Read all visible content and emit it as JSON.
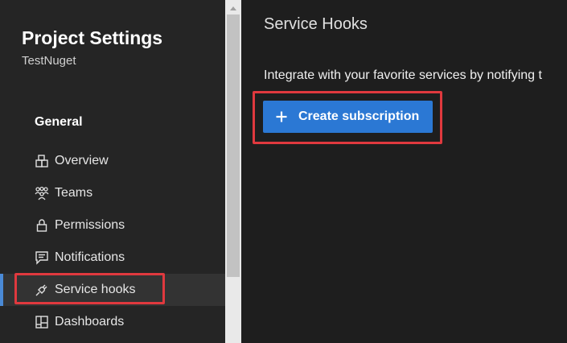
{
  "sidebar": {
    "title": "Project Settings",
    "subtitle": "TestNuget",
    "section": "General",
    "items": [
      {
        "label": "Overview",
        "icon": "overview-icon"
      },
      {
        "label": "Teams",
        "icon": "teams-icon"
      },
      {
        "label": "Permissions",
        "icon": "lock-icon"
      },
      {
        "label": "Notifications",
        "icon": "notifications-icon"
      },
      {
        "label": "Service hooks",
        "icon": "plug-icon",
        "selected": true
      },
      {
        "label": "Dashboards",
        "icon": "dashboards-icon"
      }
    ]
  },
  "main": {
    "title": "Service Hooks",
    "description": "Integrate with your favorite services by notifying t",
    "create_button": {
      "label": "Create subscription",
      "icon": "plus-icon"
    }
  },
  "colors": {
    "sidebar_bg": "#252525",
    "main_bg": "#1e1e1e",
    "accent": "#2b78d4",
    "highlight_border": "#e0393e",
    "selected_bar": "#4a8ad6"
  }
}
